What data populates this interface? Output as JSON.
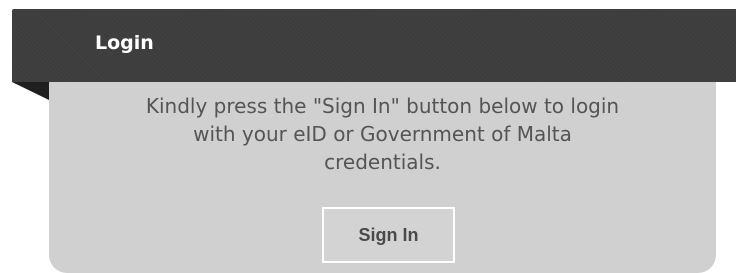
{
  "login": {
    "title": "Login",
    "message_lines": [
      "Kindly press the \"Sign In\" button below to login",
      "with your eID or Government of Malta",
      "credentials."
    ],
    "signin_label": "Sign In"
  },
  "colors": {
    "header_bg": "#3d3d3d",
    "panel_bg": "#d0d0d0",
    "button_border": "#ffffff",
    "text": "#555555"
  }
}
